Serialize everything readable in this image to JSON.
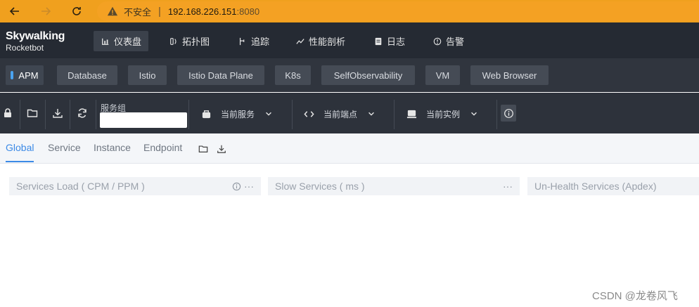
{
  "browser": {
    "insecure_label": "不安全",
    "url_host": "192.168.226.151",
    "url_port": ":8080"
  },
  "app": {
    "logo_main": "Skywalking",
    "logo_sub": "Rocketbot"
  },
  "topnav": {
    "items": [
      {
        "label": "仪表盘",
        "icon": "dashboard-icon",
        "active": true
      },
      {
        "label": "拓扑图",
        "icon": "topology-icon",
        "active": false
      },
      {
        "label": "追踪",
        "icon": "trace-icon",
        "active": false
      },
      {
        "label": "性能剖析",
        "icon": "profile-icon",
        "active": false
      },
      {
        "label": "日志",
        "icon": "log-icon",
        "active": false
      },
      {
        "label": "告警",
        "icon": "alarm-icon",
        "active": false
      }
    ]
  },
  "layers": {
    "tabs": [
      {
        "label": "APM",
        "active": true
      },
      {
        "label": "Database",
        "active": false
      },
      {
        "label": "Istio",
        "active": false
      },
      {
        "label": "Istio Data Plane",
        "active": false
      },
      {
        "label": "K8s",
        "active": false
      },
      {
        "label": "SelfObservability",
        "active": false
      },
      {
        "label": "VM",
        "active": false
      },
      {
        "label": "Web Browser",
        "active": false
      }
    ]
  },
  "toolbar": {
    "service_group_label": "服务组",
    "service_group_value": "",
    "current_service": "当前服务",
    "current_endpoint": "当前端点",
    "current_instance": "当前实例"
  },
  "dashboard_tabs": {
    "tabs": [
      {
        "label": "Global",
        "active": true
      },
      {
        "label": "Service",
        "active": false
      },
      {
        "label": "Instance",
        "active": false
      },
      {
        "label": "Endpoint",
        "active": false
      }
    ]
  },
  "widgets": [
    {
      "title": "Services Load ( CPM / PPM )",
      "has_info": true
    },
    {
      "title": "Slow Services ( ms )",
      "has_info": false
    },
    {
      "title": "Un-Health Services (Apdex)",
      "has_info": false
    }
  ],
  "watermark": "CSDN @龙卷风飞",
  "colors": {
    "browser_bar": "#f0a01e",
    "nav_bg": "#252a33",
    "accent": "#3c8ae6"
  }
}
